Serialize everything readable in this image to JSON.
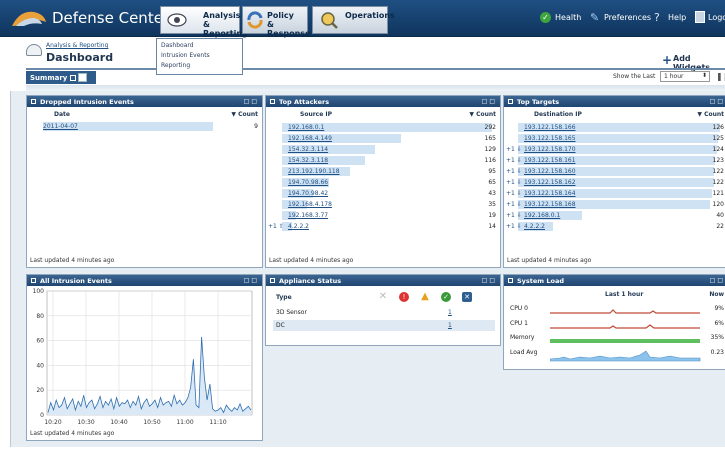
{
  "app": {
    "name": "Defense Center"
  },
  "nav": {
    "tabs": [
      {
        "label1": "Analysis &",
        "label2": "Reporting"
      },
      {
        "label1": "Policy &",
        "label2": "Response"
      },
      {
        "label1": "Operations"
      }
    ],
    "health": "Health",
    "preferences": "Preferences",
    "help": "Help",
    "logout": "Logo"
  },
  "menu": [
    "Dashboard",
    "Intrusion Events",
    "Reporting"
  ],
  "breadcrumb": "Analysis & Reporting",
  "page_title": "Dashboard",
  "add_widgets": "Add Widgets",
  "summary_tab": "Summary",
  "show_last": {
    "label": "Show the Last",
    "value": "1 hour"
  },
  "widgets": {
    "dropped": {
      "title": "Dropped Intrusion Events",
      "columns": [
        "Date",
        "▼ Count"
      ],
      "rows": [
        {
          "date": "2011-04-07",
          "count": "9",
          "fraction": 0.75
        }
      ],
      "footer": "Last updated 4 minutes ago"
    },
    "attackers": {
      "title": "Top Attackers",
      "columns": [
        "Source IP",
        "▼ Count"
      ],
      "rows": [
        {
          "ip": "192.168.0.1",
          "count": "292"
        },
        {
          "ip": "192.168.4.149",
          "count": "165"
        },
        {
          "ip": "154.32.3.114",
          "count": "129"
        },
        {
          "ip": "154.32.3.118",
          "count": "116"
        },
        {
          "ip": "213.192.190.118",
          "count": "95"
        },
        {
          "ip": "194.70.98.66",
          "count": "65"
        },
        {
          "ip": "194.70.98.42",
          "count": "43"
        },
        {
          "ip": "192.168.4.178",
          "count": "35"
        },
        {
          "ip": "192.168.3.77",
          "count": "19"
        },
        {
          "ip": "4.2.2.2",
          "count": "14",
          "prefix": "+1"
        }
      ],
      "footer": "Last updated 4 minutes ago"
    },
    "targets": {
      "title": "Top Targets",
      "columns": [
        "Destination IP",
        "▼ Count"
      ],
      "rows": [
        {
          "ip": "193.122.158.166",
          "count": "126"
        },
        {
          "ip": "193.122.158.165",
          "count": "125"
        },
        {
          "ip": "193.122.158.170",
          "count": "124",
          "prefix": "+1"
        },
        {
          "ip": "193.122.158.161",
          "count": "123",
          "prefix": "+1"
        },
        {
          "ip": "193.122.158.160",
          "count": "122",
          "prefix": "+1"
        },
        {
          "ip": "193.122.158.162",
          "count": "122",
          "prefix": "+1"
        },
        {
          "ip": "193.122.158.164",
          "count": "121",
          "prefix": "+1"
        },
        {
          "ip": "193.122.158.168",
          "count": "120",
          "prefix": "+1"
        },
        {
          "ip": "192.168.0.1",
          "count": "40",
          "prefix": "+1"
        },
        {
          "ip": "4.2.2.2",
          "count": "22",
          "prefix": "+1"
        }
      ],
      "footer": "Last updated 4 minutes ago"
    },
    "all_events": {
      "title": "All Intrusion Events",
      "footer": "Last updated 4 minutes ago"
    },
    "appliance": {
      "title": "Appliance Status",
      "columns": [
        "Type"
      ],
      "rows": [
        {
          "type": "3D Sensor",
          "count": "1"
        },
        {
          "type": "DC",
          "count": "1"
        }
      ]
    },
    "sysload": {
      "title": "System Load",
      "columns": [
        "Last 1 hour",
        "Now"
      ],
      "rows": [
        {
          "label": "CPU 0",
          "now": "9%"
        },
        {
          "label": "CPU 1",
          "now": "6%"
        },
        {
          "label": "Memory",
          "now": "35%"
        },
        {
          "label": "Load Avg",
          "now": "0.23"
        }
      ]
    }
  },
  "colors": {
    "header": "#1f4570",
    "bar": "#cfe2f3",
    "line": "#2f6fb0"
  },
  "chart_data": {
    "type": "line",
    "x": [
      "10:20",
      "10:30",
      "10:40",
      "10:50",
      "11:00",
      "11:10"
    ],
    "x_tick_labels": [
      "10:20",
      "10:30",
      "10:40",
      "10:50",
      "11:00",
      "11:10"
    ],
    "y_tick_labels": [
      "0",
      "20",
      "40",
      "60",
      "80",
      "100"
    ],
    "ylim": [
      0,
      100
    ],
    "grid": true,
    "series": [
      {
        "values": [
          2,
          10,
          4,
          12,
          6,
          8,
          14,
          5,
          9,
          13,
          4,
          11,
          7,
          16,
          6,
          10,
          12,
          5,
          9,
          15,
          6,
          11,
          8,
          13,
          5,
          14,
          7,
          10,
          9,
          12,
          6,
          11,
          8,
          15,
          5,
          10,
          13,
          7,
          9,
          12,
          6,
          14,
          8,
          10,
          11,
          7,
          16,
          9,
          12,
          8,
          10,
          14,
          22,
          45,
          8,
          6,
          63,
          30,
          12,
          25,
          5,
          3,
          4,
          6,
          2,
          8,
          5,
          3,
          6,
          4,
          9,
          3,
          5,
          7,
          4
        ]
      }
    ]
  }
}
